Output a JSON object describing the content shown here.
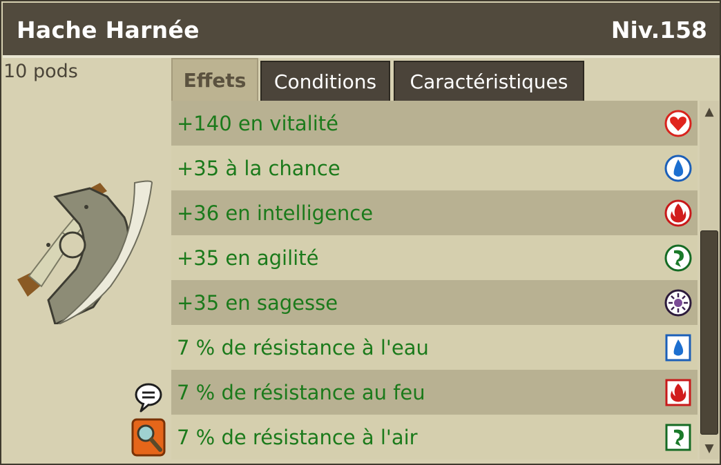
{
  "item": {
    "name": "Hache Harnée",
    "level": "Niv.158",
    "weight": "10 pods"
  },
  "tabs": [
    {
      "label": "Effets",
      "active": true
    },
    {
      "label": "Conditions",
      "active": false
    },
    {
      "label": "Caractéristiques",
      "active": false
    }
  ],
  "effects": [
    {
      "text": "+140 en vitalité",
      "icon": "vitality-heart-icon"
    },
    {
      "text": "+35 à la chance",
      "icon": "water-drop-icon"
    },
    {
      "text": "+36 en intelligence",
      "icon": "fire-icon"
    },
    {
      "text": "+35 en agilité",
      "icon": "air-icon"
    },
    {
      "text": "+35 en sagesse",
      "icon": "wisdom-icon"
    },
    {
      "text": "7 % de résistance à l'eau",
      "icon": "water-resistance-icon"
    },
    {
      "text": "7 % de résistance au feu",
      "icon": "fire-resistance-icon"
    },
    {
      "text": "7 % de résistance à l'air",
      "icon": "air-resistance-icon"
    }
  ],
  "colors": {
    "header": "#514a3d",
    "effect_text": "#1b7a1b",
    "row_dark": "#b8b192",
    "row_light": "#d5cfae"
  }
}
